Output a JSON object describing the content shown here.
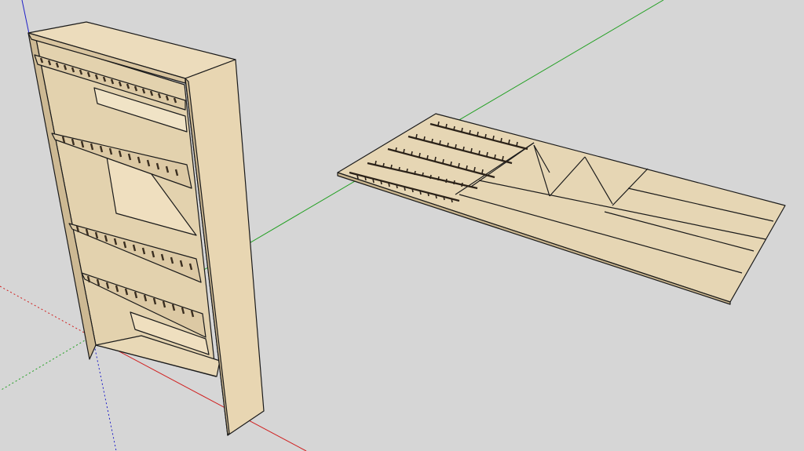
{
  "viewport": {
    "background": "#d6d6d6",
    "axes": {
      "red": "#d02020",
      "green": "#22a022",
      "blue": "#2020c8"
    },
    "wood": {
      "face": "#e6d6b5",
      "light": "#efe2c4",
      "shade": "#c9b58e",
      "edge": "#1a1a1a"
    }
  },
  "scene": {
    "models": [
      {
        "name": "assembled-bookshelf"
      },
      {
        "name": "cut-sheet-layout"
      }
    ]
  }
}
